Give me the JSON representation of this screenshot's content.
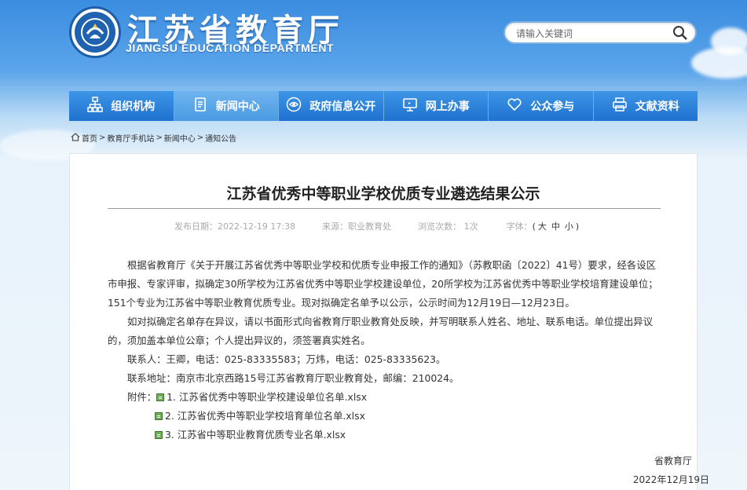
{
  "header": {
    "title": "江苏省教育厅",
    "subtitle": "JIANGSU EDUCATION DEPARTMENT",
    "search_placeholder": "请输入关键词"
  },
  "nav": [
    {
      "label": "组织机构",
      "icon": "org-chart-icon"
    },
    {
      "label": "新闻中心",
      "icon": "document-icon",
      "active": true
    },
    {
      "label": "政府信息公开",
      "icon": "eye-icon"
    },
    {
      "label": "网上办事",
      "icon": "monitor-icon"
    },
    {
      "label": "公众参与",
      "icon": "heart-icon"
    },
    {
      "label": "文献资料",
      "icon": "printer-icon"
    }
  ],
  "breadcrumb": {
    "items": [
      "首页",
      "教育厅手机站",
      "新闻中心",
      "通知公告"
    ],
    "sep": ">"
  },
  "article": {
    "title": "江苏省优秀中等职业学校优质专业遴选结果公示",
    "publish_date": "发布日期：2022-12-19 17:38",
    "source": "来源：职业教育处",
    "views": "浏览次数：  1次",
    "font_label": "字体：",
    "font_sizes": [
      "大",
      "中",
      "小"
    ],
    "paragraphs": [
      "根据省教育厅《关于开展江苏省优秀中等职业学校和优质专业申报工作的通知》（苏教职函〔2022〕41号）要求，经各设区市申报、专家评审，拟确定30所学校为江苏省优秀中等职业学校建设单位，20所学校为江苏省优秀中等职业学校培育建设单位；151个专业为江苏省中等职业教育优质专业。现对拟确定名单予以公示，公示时间为12月19日—12月23日。",
      "如对拟确定名单存在异议，请以书面形式向省教育厅职业教育处反映，并写明联系人姓名、地址、联系电话。单位提出异议的，须加盖本单位公章；个人提出异议的，须签署真实姓名。"
    ],
    "contact": "联系人：王卿，电话：025-83335583；万炜，电话：025-83335623。",
    "address": "联系地址：南京市北京西路15号江苏省教育厅职业教育处，邮编：210024。",
    "attach_label": "附件：",
    "attachments": [
      "1. 江苏省优秀中等职业学校建设单位名单.xlsx",
      "2. 江苏省优秀中等职业学校培育单位名单.xlsx",
      "3. 江苏省中等职业教育优质专业名单.xlsx"
    ],
    "signature": "省教育厅",
    "date": "2022年12月19日"
  }
}
